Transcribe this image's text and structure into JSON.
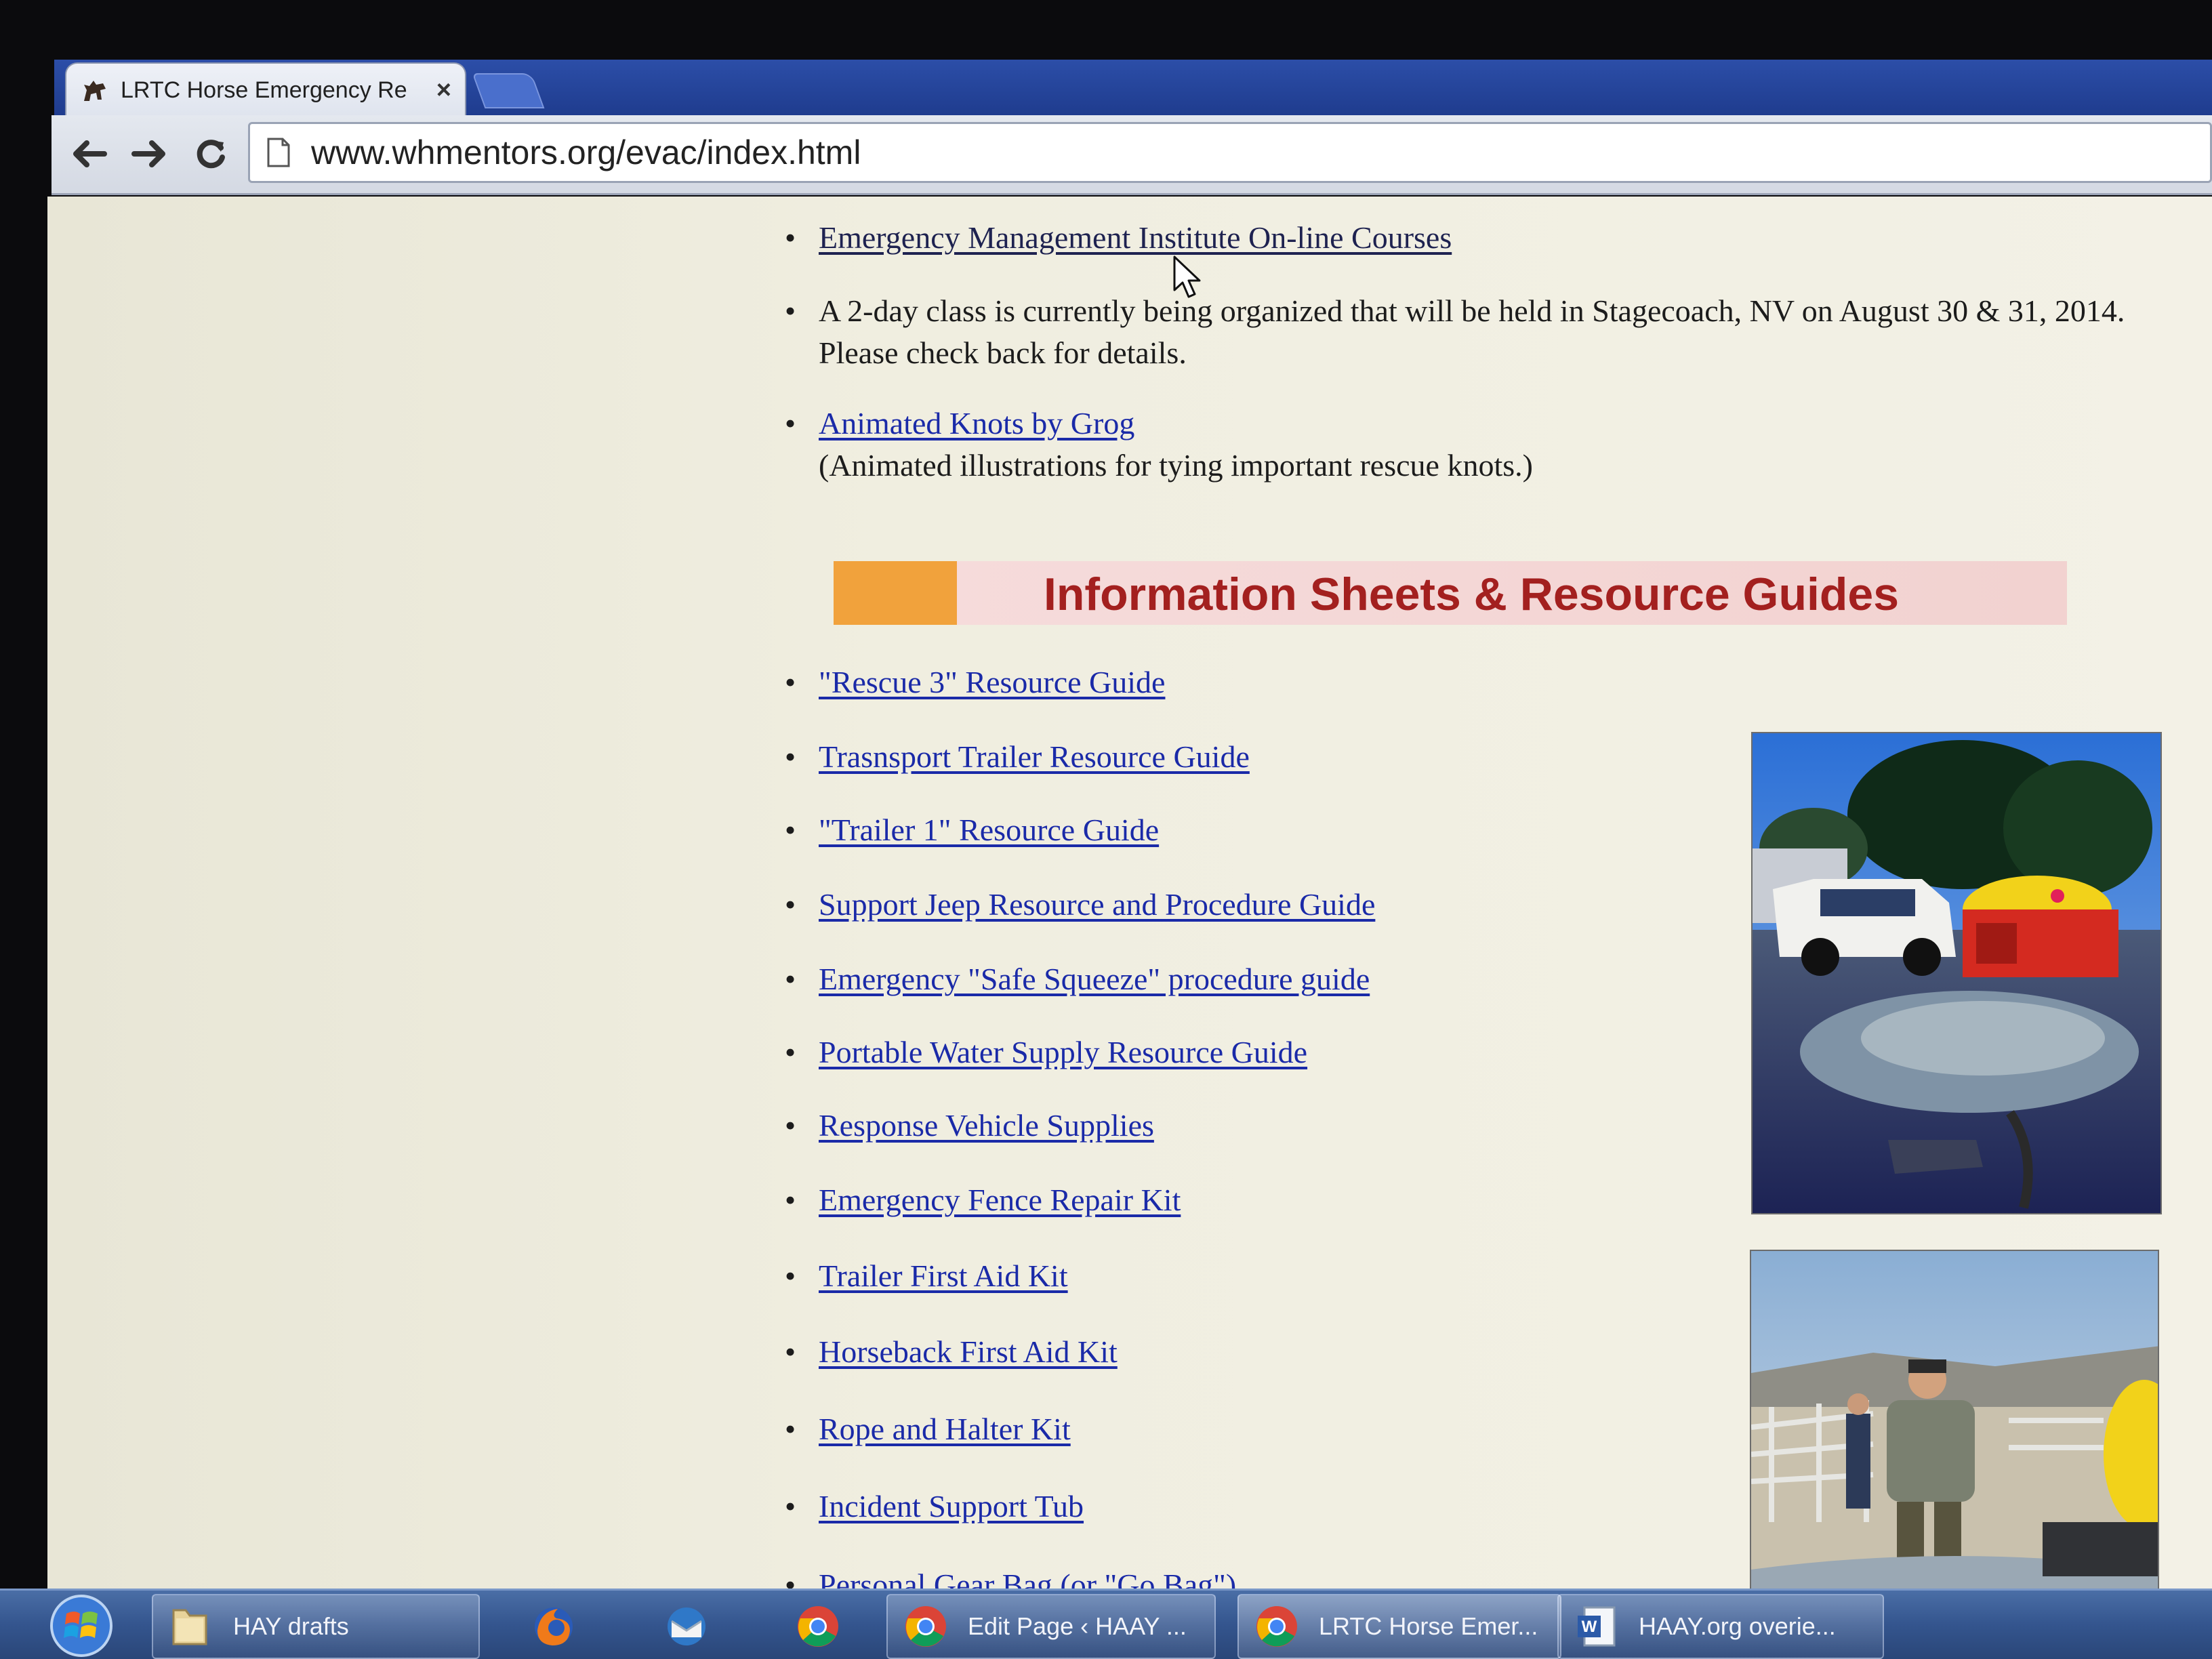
{
  "browser": {
    "tab_title": "LRTC Horse Emergency Re",
    "tab_close": "×",
    "url": "www.whmentors.org/evac/index.html"
  },
  "page": {
    "top_items": [
      {
        "link": "Emergency Management Institute On-line Courses"
      },
      {
        "text_line1": "A 2-day class is currently being organized that will be held in Stagecoach, NV on August 30 & 31, 2014.",
        "text_line2": "Please check back for details."
      },
      {
        "link": "Animated Knots by Grog",
        "note": "(Animated illustrations for tying important rescue knots.)"
      }
    ],
    "section_title": "Information Sheets & Resource Guides",
    "resources": [
      "\"Rescue 3\" Resource Guide",
      "Trasnsport Trailer Resource Guide",
      "\"Trailer 1\" Resource Guide",
      "Support Jeep Resource and Procedure Guide",
      "Emergency \"Safe Squeeze\" procedure guide",
      "Portable Water Supply Resource Guide",
      "Response Vehicle Supplies",
      "Emergency Fence Repair Kit",
      "Trailer First Aid Kit",
      "Horseback First Aid Kit",
      "Rope and Halter Kit",
      "Incident Support Tub",
      "Personal Gear Bag (or \"Go Bag\")"
    ],
    "bullet": "•"
  },
  "taskbar": {
    "items": [
      {
        "label": "HAY drafts",
        "icon": "folder-icon"
      },
      {
        "label": "",
        "icon": "firefox-icon"
      },
      {
        "label": "",
        "icon": "thunderbird-icon"
      },
      {
        "label": "",
        "icon": "chrome-icon"
      },
      {
        "label": "Edit Page ‹ HAAY ...",
        "icon": "chrome-icon"
      },
      {
        "label": "LRTC Horse Emer...",
        "icon": "chrome-icon"
      },
      {
        "label": "HAAY.org overie...",
        "icon": "word-icon"
      }
    ]
  },
  "colors": {
    "link": "#1a2aa8",
    "section_title": "#a3201f",
    "banner_accent": "#f1a23c",
    "banner_bg": "#f6dcdc",
    "page_bg": "#f0eee0"
  }
}
